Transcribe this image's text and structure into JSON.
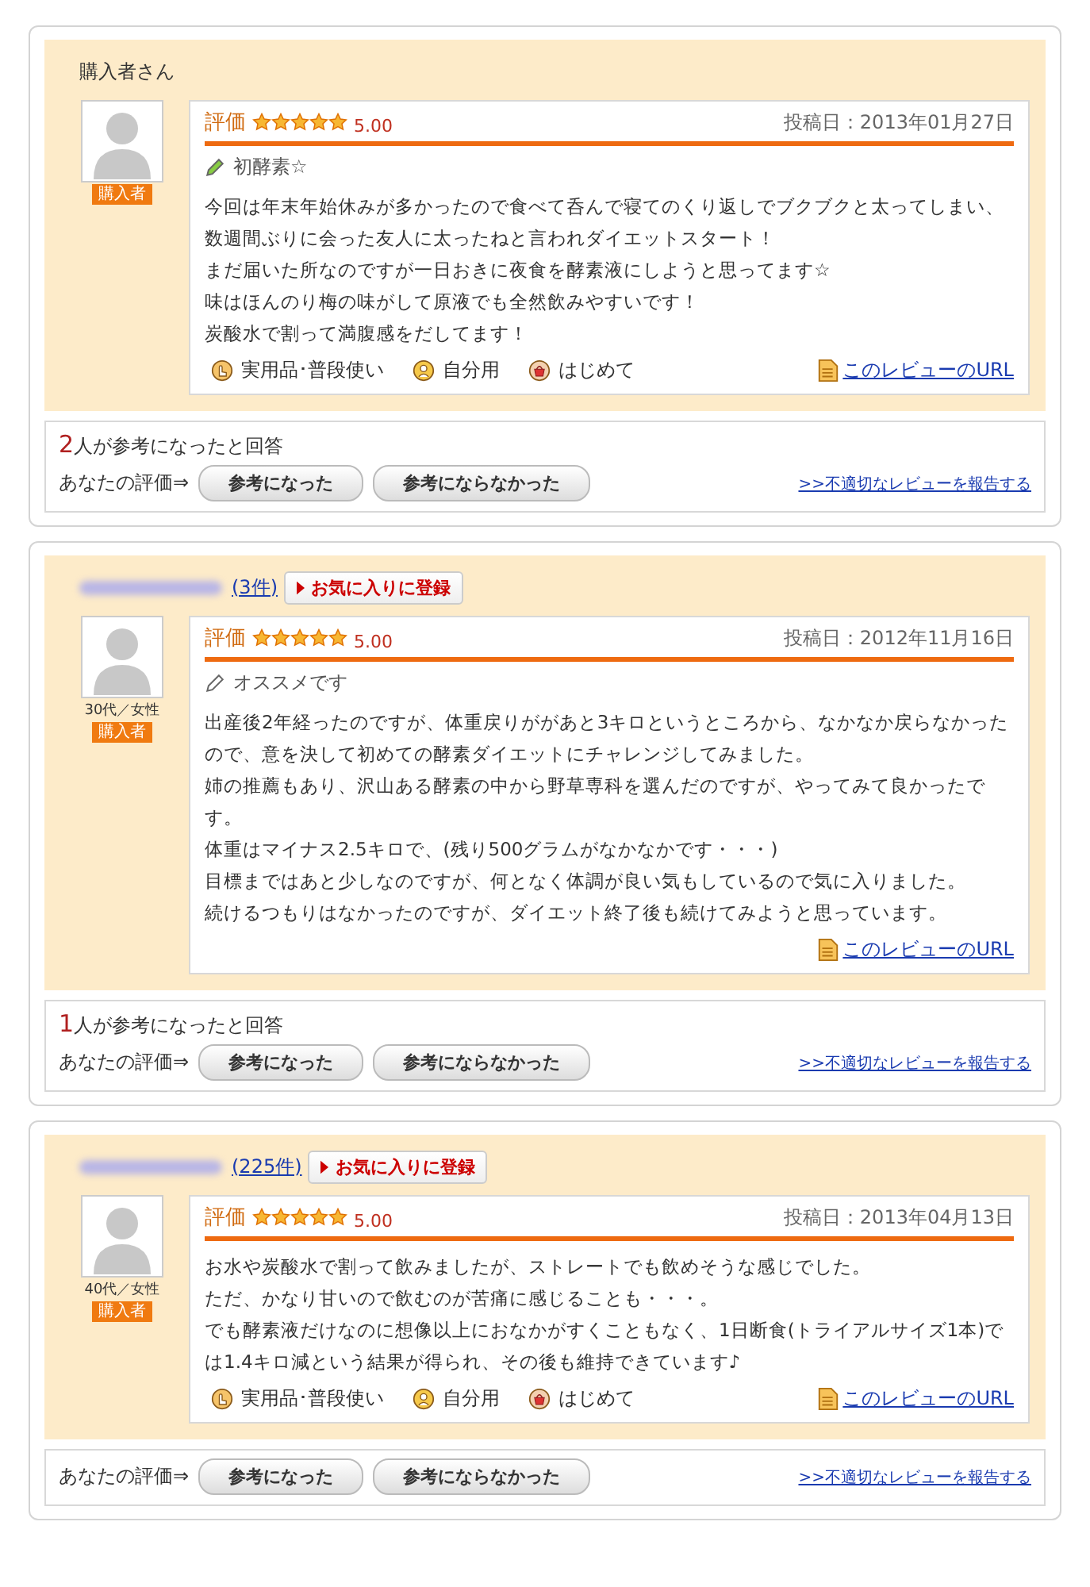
{
  "reviews": [
    {
      "reviewer": {
        "name": "購入者さん",
        "name_hidden": false
      },
      "badge": "購入者",
      "rating_label": "評価",
      "stars": 5,
      "score": "5.00",
      "date": "投稿日：2013年01月27日",
      "title": "初酵素☆",
      "body": [
        "今回は年末年始休みが多かったので食べて呑んで寝てのくり返しでブクブクと太ってしまい、数週間ぶりに会った友人に太ったねと言われダイエットスタート！",
        "まだ届いた所なのですが一日おきに夜食を酵素液にしようと思ってます☆",
        "味はほんのり梅の味がして原液でも全然飲みやすいです！",
        "炭酸水で割って満腹感をだしてます！"
      ],
      "tags": [
        {
          "kind": "usage",
          "label": "実用品･普段使い"
        },
        {
          "kind": "recipient",
          "label": "自分用"
        },
        {
          "kind": "frequency",
          "label": "はじめて"
        }
      ],
      "url_link": "このレビューのURL",
      "helpful": {
        "count": "2",
        "text": "人が参考になったと回答"
      },
      "your_rating": "あなたの評価⇒",
      "buttons": [
        "参考になった",
        "参考にならなかった"
      ],
      "report_link": ">>不適切なレビューを報告する"
    },
    {
      "reviewer": {
        "name_hidden": true,
        "count": "(3件)",
        "favorite_button": "お気に入りに登録"
      },
      "demographic": "30代／女性",
      "badge": "購入者",
      "rating_label": "評価",
      "stars": 5,
      "score": "5.00",
      "date": "投稿日：2012年11月16日",
      "title": "オススメです",
      "body": [
        "出産後2年経ったのですが、体重戻りががあと3キロというところから、なかなか戻らなかったので、意を決して初めての酵素ダイエットにチャレンジしてみました。",
        "姉の推薦もあり、沢山ある酵素の中から野草専科を選んだのですが、やってみて良かったです。",
        "体重はマイナス2.5キロで、(残り500グラムがなかなかです・・・)",
        "目標まではあと少しなのですが、何となく体調が良い気もしているので気に入りました。",
        "続けるつもりはなかったのですが、ダイエット終了後も続けてみようと思っています。"
      ],
      "url_link": "このレビューのURL",
      "helpful": {
        "count": "1",
        "text": "人が参考になったと回答"
      },
      "your_rating": "あなたの評価⇒",
      "buttons": [
        "参考になった",
        "参考にならなかった"
      ],
      "report_link": ">>不適切なレビューを報告する"
    },
    {
      "reviewer": {
        "name_hidden": true,
        "count": "(225件)",
        "favorite_button": "お気に入りに登録"
      },
      "demographic": "40代／女性",
      "badge": "購入者",
      "rating_label": "評価",
      "stars": 5,
      "score": "5.00",
      "date": "投稿日：2013年04月13日",
      "body": [
        "お水や炭酸水で割って飲みましたが、ストレートでも飲めそうな感じでした。",
        "ただ、かなり甘いので飲むのが苦痛に感じることも・・・。",
        "でも酵素液だけなのに想像以上におなかがすくこともなく、1日断食(トライアルサイズ1本)では1.4キロ減という結果が得られ、その後も維持できています♪"
      ],
      "tags": [
        {
          "kind": "usage",
          "label": "実用品･普段使い"
        },
        {
          "kind": "recipient",
          "label": "自分用"
        },
        {
          "kind": "frequency",
          "label": "はじめて"
        }
      ],
      "url_link": "このレビューのURL",
      "your_rating": "あなたの評価⇒",
      "buttons": [
        "参考になった",
        "参考にならなかった"
      ],
      "report_link": ">>不適切なレビューを報告する"
    }
  ]
}
